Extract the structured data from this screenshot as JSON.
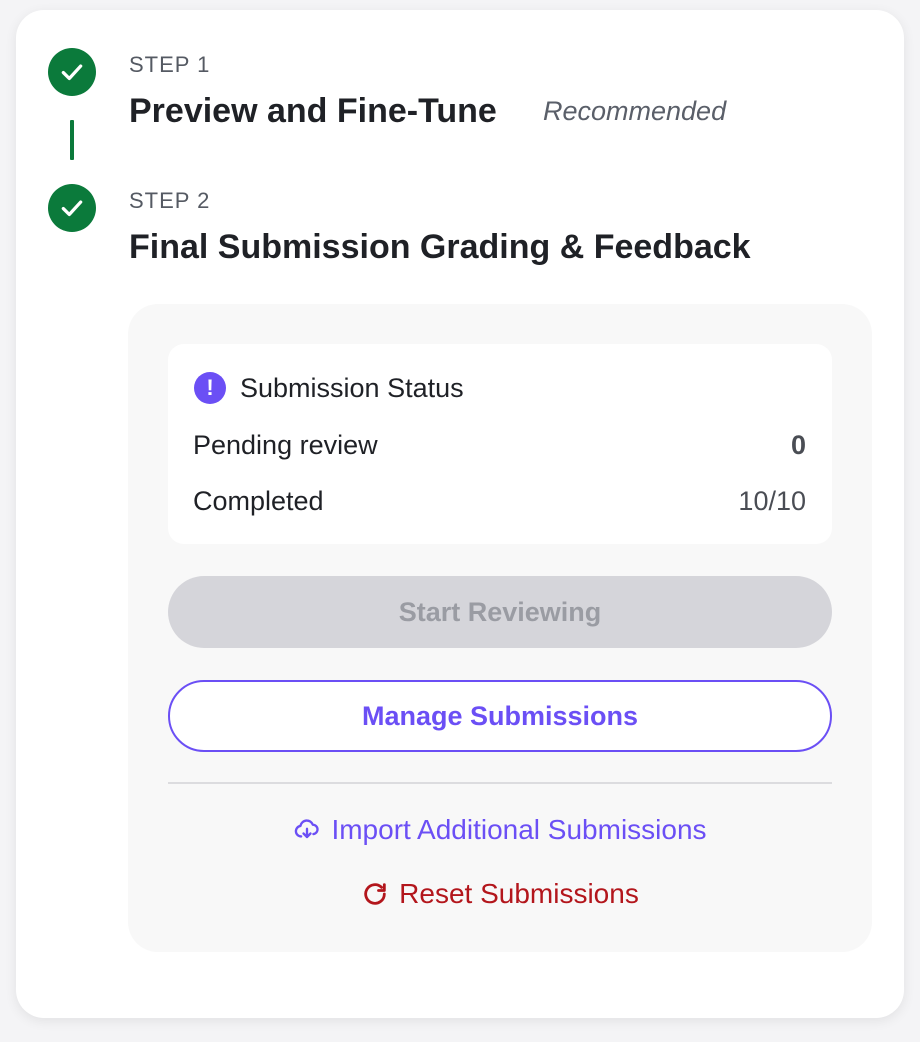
{
  "steps": [
    {
      "label": "STEP 1",
      "title": "Preview and Fine-Tune",
      "tag": "Recommended",
      "status": "complete"
    },
    {
      "label": "STEP 2",
      "title": "Final Submission Grading & Feedback",
      "status": "complete"
    }
  ],
  "status": {
    "title": "Submission Status",
    "rows": [
      {
        "label": "Pending review",
        "value": "0"
      },
      {
        "label": "Completed",
        "value": "10/10"
      }
    ]
  },
  "actions": {
    "start_reviewing": "Start Reviewing",
    "manage": "Manage Submissions",
    "import": "Import Additional Submissions",
    "reset": "Reset Submissions"
  },
  "colors": {
    "success": "#0b7a3b",
    "accent": "#6b4ff5",
    "danger": "#b3161c",
    "disabled": "#d5d5da"
  },
  "icons": {
    "step_complete": "check-icon",
    "status": "exclamation-icon",
    "import": "cloud-upload-icon",
    "reset": "refresh-icon"
  }
}
